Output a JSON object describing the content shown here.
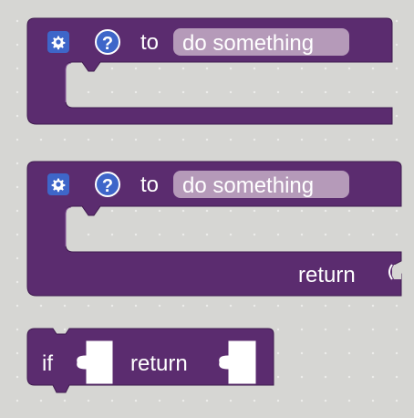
{
  "workspace": {
    "background": "#d6d6d3",
    "grid_dot_color": "#ececec"
  },
  "colors": {
    "block": "#5b2c6f",
    "block_border": "#3f1b4f",
    "field": "#b59ab9",
    "settings_icon_bg": "#3e66c9",
    "help_icon_bg": "#3e66c9",
    "text": "#ffffff"
  },
  "blocks": [
    {
      "type": "procedure-def-noreturn",
      "settings_icon": "gear-icon",
      "help_icon": "question-icon",
      "help_glyph": "?",
      "keyword": "to",
      "name_field": "do something"
    },
    {
      "type": "procedure-def-return",
      "settings_icon": "gear-icon",
      "help_icon": "question-icon",
      "help_glyph": "?",
      "keyword": "to",
      "name_field": "do something",
      "return_label": "return"
    },
    {
      "type": "procedure-if-return",
      "if_label": "if",
      "return_label": "return"
    }
  ]
}
